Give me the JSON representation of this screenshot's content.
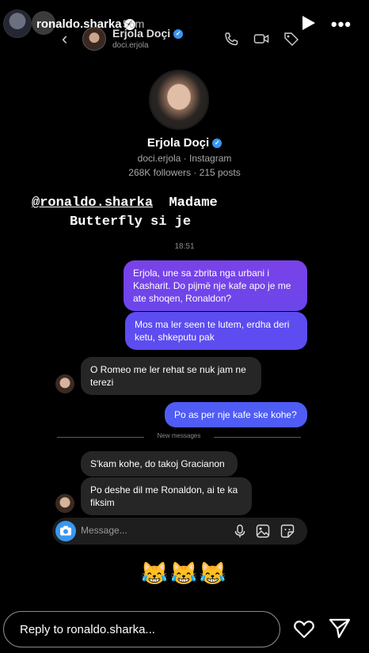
{
  "story": {
    "username": "ronaldo.sharka",
    "time": "56m"
  },
  "dm": {
    "contact_name": "Erjola Doçi",
    "contact_handle": "doci.erjola"
  },
  "profile": {
    "name": "Erjola Doçi",
    "subtitle": "doci.erjola · Instagram",
    "stats": "268K followers · 215 posts"
  },
  "overlay": {
    "mention": "@ronaldo.sharka",
    "line1_rest": "Madame",
    "line2": "Butterfly si je"
  },
  "timestamp": "18:51",
  "messages": {
    "sent1": "Erjola, une sa zbrita nga urbani i Kasharit. Do pijmë nje kafe apo je me ate shoqen, Ronaldon?",
    "sent2": "Mos ma ler seen te lutem, erdha deri ketu, shkeputu pak",
    "recv1": "O Romeo me ler rehat se nuk jam ne terezi",
    "sent3": "Po as per nje kafe ske kohe?",
    "new_label": "New messages",
    "recv2": "S'kam kohe, do takoj Gracianon",
    "recv3": "Po deshe dil me Ronaldon, ai te ka fiksim"
  },
  "composer": {
    "placeholder": "Message..."
  },
  "emojis": "😹😹😹",
  "reply": {
    "placeholder": "Reply to ronaldo.sharka..."
  },
  "colors": {
    "accent_blue": "#3897f0",
    "sent_purple": "#5c4bf0",
    "received_gray": "#262626"
  },
  "icons": [
    "play-icon",
    "more-icon",
    "back-chevron-icon",
    "phone-icon",
    "video-icon",
    "tag-icon",
    "camera-icon",
    "mic-icon",
    "gallery-icon",
    "sticker-icon",
    "heart-icon",
    "send-icon",
    "verified-icon"
  ]
}
